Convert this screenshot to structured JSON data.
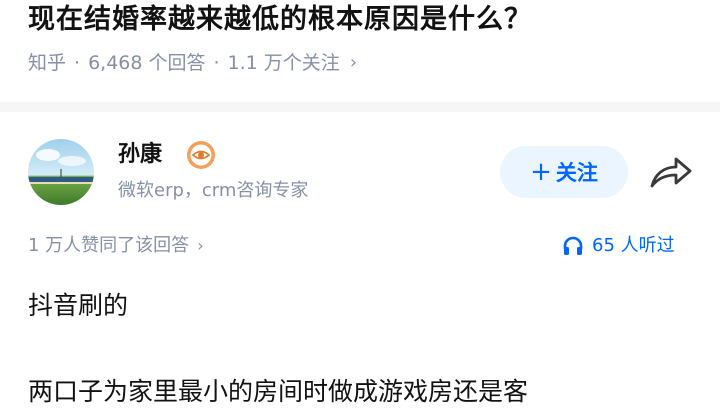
{
  "question": {
    "title": "现在结婚率越来越低的根本原因是什么？",
    "source": "知乎",
    "answers_count": "6,468 个回答",
    "followers_count": "1.1 万个关注"
  },
  "author": {
    "name": "孙康",
    "bio": "微软erp，crm咨询专家",
    "follow_label": "关注"
  },
  "answer_stats": {
    "likes_text": "1 万人赞同了该回答",
    "listens_text": "65 人听过"
  },
  "answer_body": {
    "paragraph_1": "抖音刷的",
    "paragraph_2": "两口子为家里最小的房间时做成游戏房还是客"
  },
  "colors": {
    "accent": "#0066ff",
    "muted": "#8590a6",
    "follow_bg": "#ebf5ff"
  },
  "icons": {
    "badge": "eye-badge-icon",
    "share": "share-arrow-icon",
    "listen": "headphones-icon",
    "chevron": "chevron-right-icon"
  }
}
